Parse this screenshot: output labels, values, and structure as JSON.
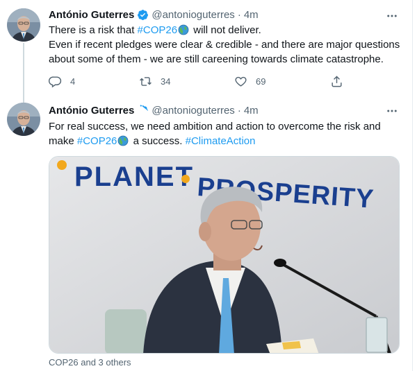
{
  "tweets": [
    {
      "author_name": "António Guterres",
      "handle": "@antonioguterres",
      "separator": "·",
      "time": "4m",
      "line1_pre": "There is a risk that ",
      "line1_tag": "#COP26",
      "line1_post": " will not deliver.",
      "line2": "Even if recent pledges were clear & credible - and there are major questions about some of them - we are still careening towards climate catastrophe.",
      "reply_count": "4",
      "retweet_count": "34",
      "like_count": "69"
    },
    {
      "author_name": "António Guterres",
      "handle": "@antonioguterres",
      "separator": "·",
      "time": "4m",
      "text_pre": "For real success, we need ambition and action to overcome the risk and make ",
      "tag1": "#COP26",
      "text_mid": " a success. ",
      "tag2": "#ClimateAction",
      "photo_words": {
        "planet": "PLANET",
        "prosperity": "PROSPERITY"
      },
      "tagged_people": "COP26 and 3 others"
    }
  ],
  "colors": {
    "link": "#1d9bf0",
    "verified": "#1d9bf0",
    "muted": "#536471",
    "text": "#0f1419",
    "banner_text": "#1a3f8f",
    "banner_dot": "#f2a81d"
  }
}
